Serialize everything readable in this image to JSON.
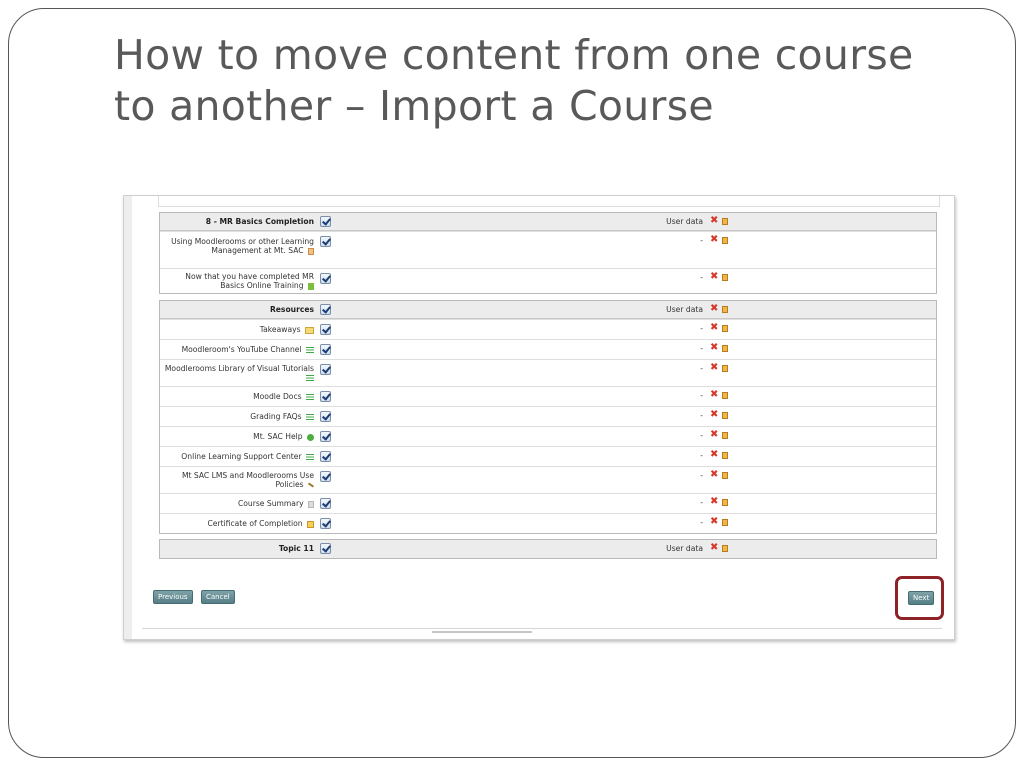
{
  "slide": {
    "title_line1": "How to move content from one course",
    "title_line2": "to another – Import a Course"
  },
  "sections": [
    {
      "heading": "8 - MR Basics Completion",
      "heading_user": "User data",
      "items": [
        {
          "label": "Using Moodlerooms or other Learning Management at Mt. SAC",
          "icon": "feedback-icon",
          "user": "-"
        },
        {
          "label": "Now that you have completed MR Basics Online Training",
          "icon": "green-file-icon",
          "user": "-"
        }
      ]
    },
    {
      "heading": "Resources",
      "heading_user": "User data",
      "items": [
        {
          "label": "Takeaways",
          "icon": "folder-icon",
          "user": "-"
        },
        {
          "label": "Moodleroom's YouTube Channel",
          "icon": "page-icon",
          "user": "-"
        },
        {
          "label": "Moodlerooms Library of Visual Tutorials",
          "icon": "page-icon",
          "user": "-"
        },
        {
          "label": "Moodle Docs",
          "icon": "page-icon",
          "user": "-"
        },
        {
          "label": "Grading FAQs",
          "icon": "page-icon",
          "user": "-"
        },
        {
          "label": "Mt. SAC Help",
          "icon": "dot-icon",
          "user": "-"
        },
        {
          "label": "Online Learning Support Center",
          "icon": "page-icon",
          "user": "-"
        },
        {
          "label": "Mt SAC LMS and Moodlerooms Use Policies",
          "icon": "pencil-icon",
          "user": "-"
        },
        {
          "label": "Course Summary",
          "icon": "grey-doc-icon",
          "user": "-"
        },
        {
          "label": "Certificate of Completion",
          "icon": "certificate-icon",
          "user": "-"
        }
      ]
    },
    {
      "heading": "Topic 11",
      "heading_user": "User data",
      "items": []
    }
  ],
  "buttons": {
    "previous": "Previous",
    "cancel": "Cancel",
    "next": "Next"
  },
  "colors": {
    "title": "#595959",
    "button": "#6a8f96",
    "highlight_ring": "#8e2227",
    "remove_x": "#d5392b"
  }
}
